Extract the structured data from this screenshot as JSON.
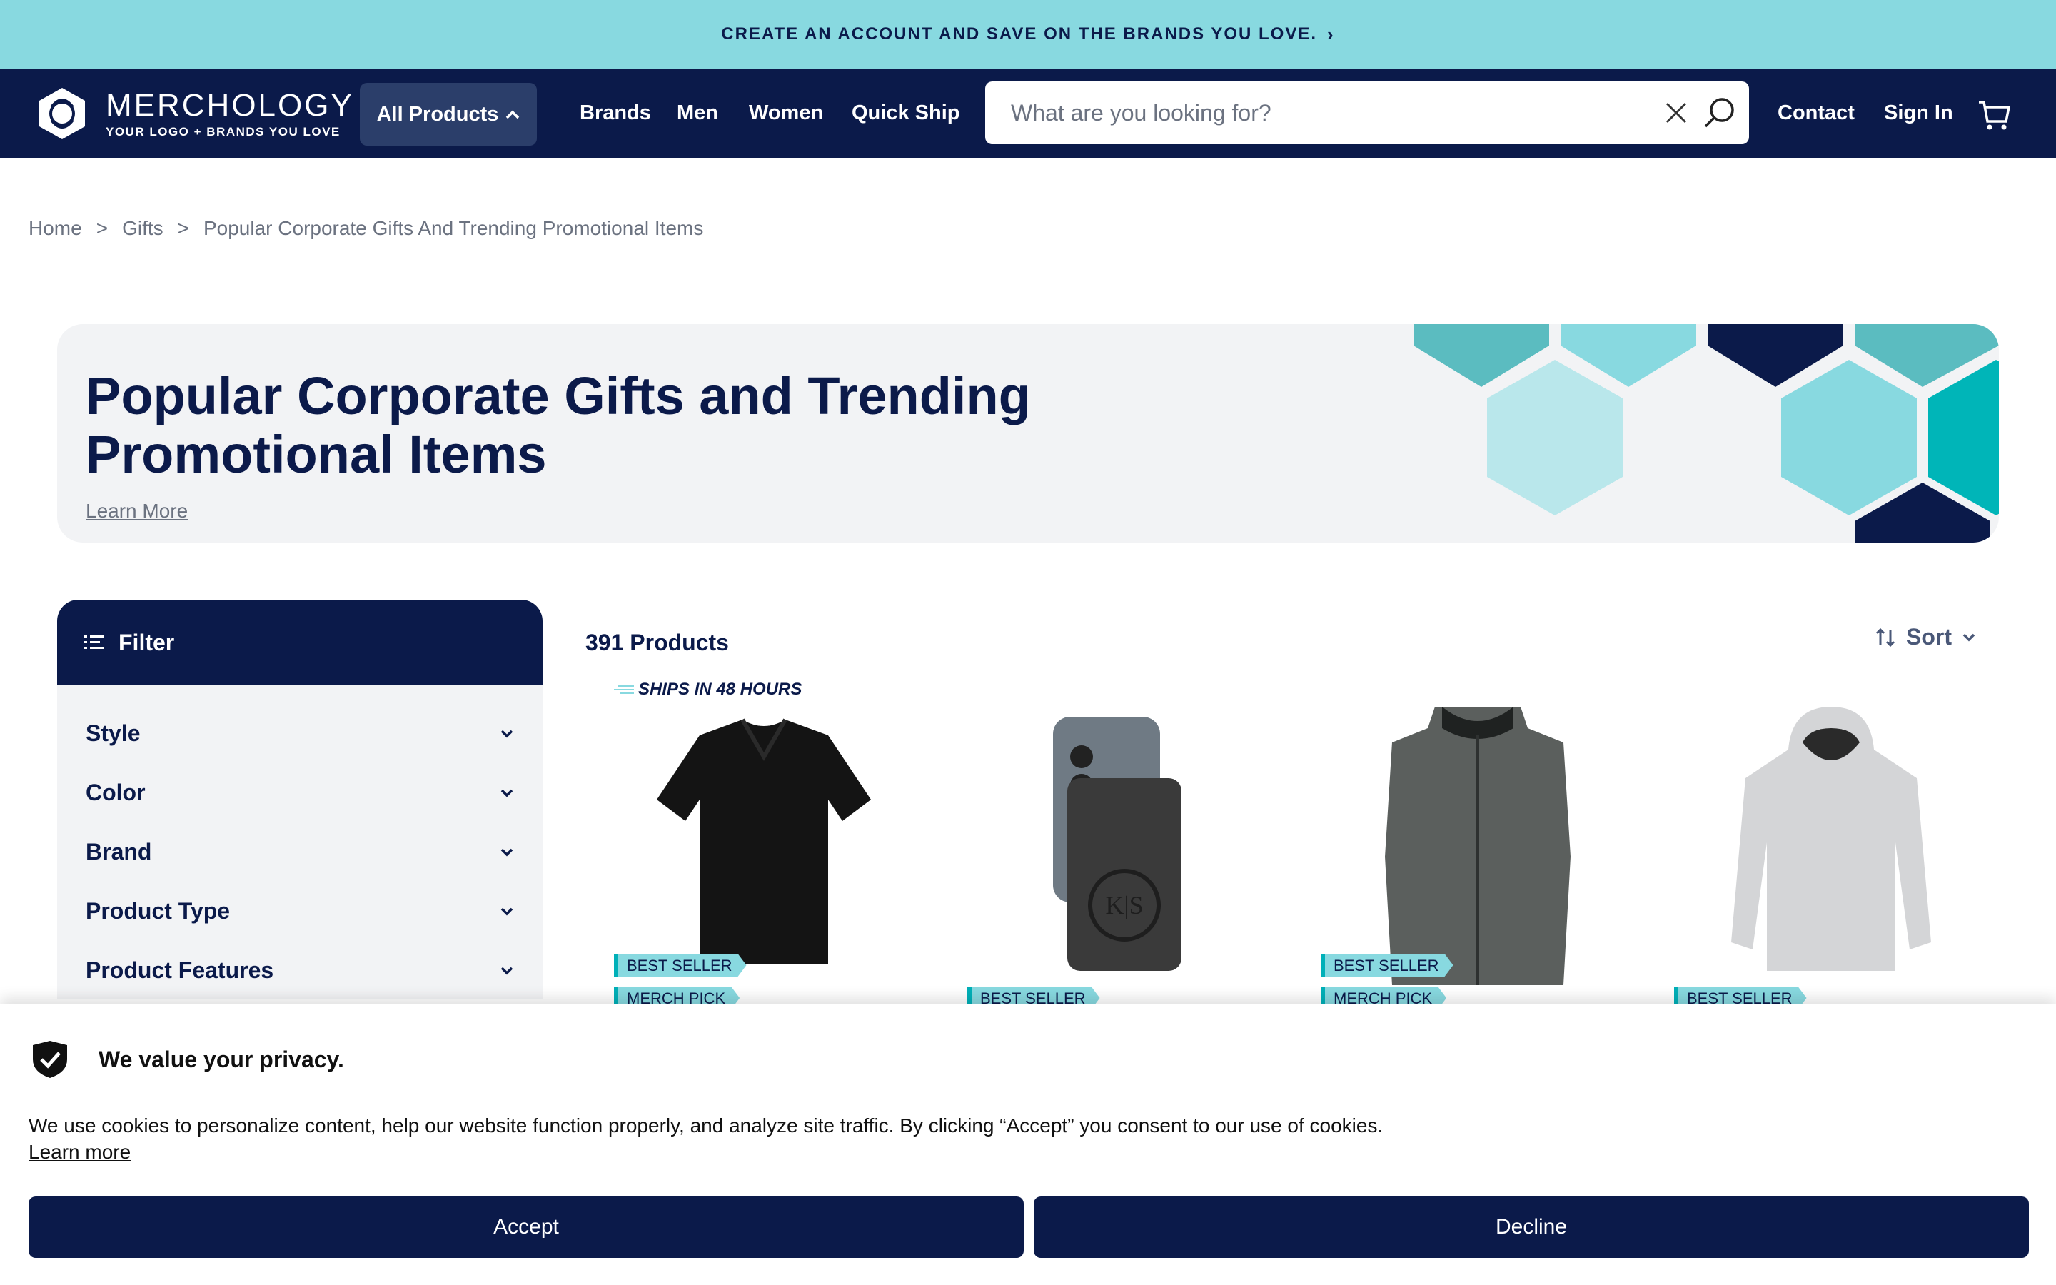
{
  "promo": {
    "text": "CREATE AN ACCOUNT AND SAVE ON THE BRANDS YOU LOVE."
  },
  "logo": {
    "name": "MERCHOLOGY",
    "tagline": "YOUR LOGO + BRANDS YOU LOVE"
  },
  "nav": {
    "all_products": "All Products",
    "links": [
      "Brands",
      "Men",
      "Women",
      "Quick Ship"
    ],
    "contact": "Contact",
    "sign_in": "Sign In"
  },
  "search": {
    "placeholder": "What are you looking for?"
  },
  "breadcrumb": [
    "Home",
    "Gifts",
    "Popular Corporate Gifts And Trending Promotional Items"
  ],
  "hero": {
    "title": "Popular Corporate Gifts and Trending Promotional Items",
    "learn_more": "Learn More"
  },
  "filter": {
    "title": "Filter",
    "facets": [
      "Style",
      "Color",
      "Brand",
      "Product Type",
      "Product Features"
    ]
  },
  "products": {
    "count": "391 Products",
    "sort": "Sort",
    "ships": "SHIPS IN 48 HOURS",
    "cards": [
      {
        "badges": [
          "BEST SELLER",
          "MERCH PICK"
        ]
      },
      {
        "badges": [
          "BEST SELLER"
        ]
      },
      {
        "badges": [
          "BEST SELLER",
          "MERCH PICK"
        ]
      },
      {
        "badges": [
          "BEST SELLER"
        ]
      }
    ]
  },
  "cookie": {
    "heading": "We value your privacy.",
    "text": "We use cookies to personalize content, help our website function properly, and analyze site traffic. By clicking “Accept” you consent to our use of cookies.",
    "learn_more": "Learn more",
    "accept": "Accept",
    "decline": "Decline"
  },
  "colors": {
    "navy": "#0b1a4a",
    "teal": "#88d9e0",
    "panel": "#f2f3f5"
  }
}
